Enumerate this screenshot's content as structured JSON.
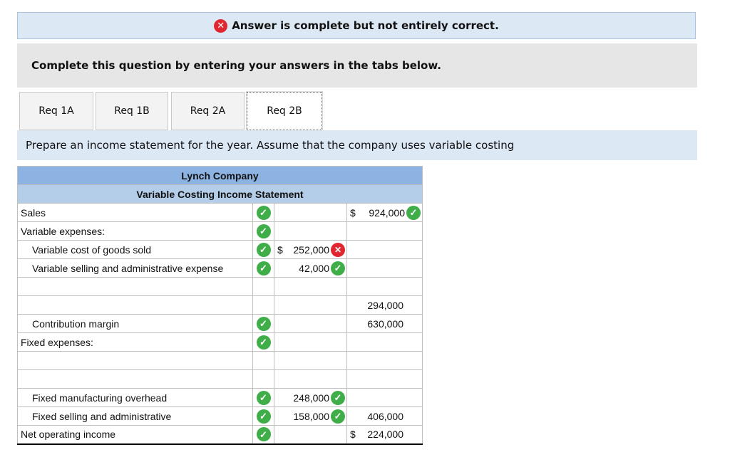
{
  "banner": {
    "text": "Answer is complete but not entirely correct."
  },
  "instructions": "Complete this question by entering your answers in the tabs below.",
  "tabs": [
    {
      "label": "Req 1A",
      "active": false
    },
    {
      "label": "Req 1B",
      "active": false
    },
    {
      "label": "Req 2A",
      "active": false
    },
    {
      "label": "Req 2B",
      "active": true
    }
  ],
  "prompt": "Prepare an income statement for the year. Assume that the company uses variable costing",
  "statement": {
    "company": "Lynch Company",
    "title": "Variable Costing Income Statement",
    "rows": [
      {
        "label": "Sales",
        "mid": "",
        "right": "924,000",
        "right_dollar": "$"
      },
      {
        "label": "Variable expenses:"
      },
      {
        "label": "Variable cost of goods sold",
        "mid": "252,000",
        "mid_dollar": "$"
      },
      {
        "label": "Variable selling and administrative expense",
        "mid": "42,000"
      },
      {
        "label": "",
        "right": "294,000"
      },
      {
        "label": "Contribution margin",
        "right": "630,000"
      },
      {
        "label": "Fixed expenses:"
      },
      {
        "label": "Fixed manufacturing overhead",
        "mid": "248,000"
      },
      {
        "label": "Fixed selling and administrative",
        "mid": "158,000",
        "right": "406,000"
      },
      {
        "label": "Net operating income",
        "right": "224,000",
        "right_dollar": "$"
      }
    ]
  },
  "colors": {
    "correct": "#3fae49",
    "incorrect": "#e0262f",
    "header": "#8db3e2",
    "banner": "#dde8f5"
  },
  "icons": {
    "correct": "check-icon",
    "incorrect": "x-icon"
  }
}
